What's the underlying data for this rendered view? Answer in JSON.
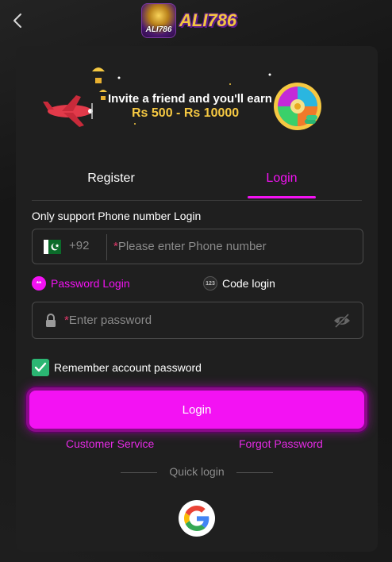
{
  "header": {
    "logo_badge_text": "ALI786",
    "logo_word": "ALI786"
  },
  "banner": {
    "line1": "Invite a friend and you'll earn",
    "line2": "Rs 500 - Rs 10000"
  },
  "tabs": [
    {
      "label": "Register",
      "active": false
    },
    {
      "label": "Login",
      "active": true
    }
  ],
  "form": {
    "support_note": "Only support Phone number Login",
    "country_code": "+92",
    "required_mark": "*",
    "phone_placeholder": "Please enter Phone number",
    "password_placeholder": "Enter password",
    "modes": {
      "password_label": "Password Login",
      "password_icon_text": "**",
      "code_label": "Code login",
      "code_icon_text": "123"
    },
    "remember_label": "Remember account password",
    "remember_checked": true,
    "login_button": "Login"
  },
  "links": {
    "customer_service": "Customer Service",
    "forgot_password": "Forgot Password"
  },
  "quick_login": {
    "label": "Quick login"
  },
  "colors": {
    "accent": "#f312f3",
    "checkbox": "#2bb673",
    "background": "#161616",
    "card": "#1f1f1f"
  }
}
